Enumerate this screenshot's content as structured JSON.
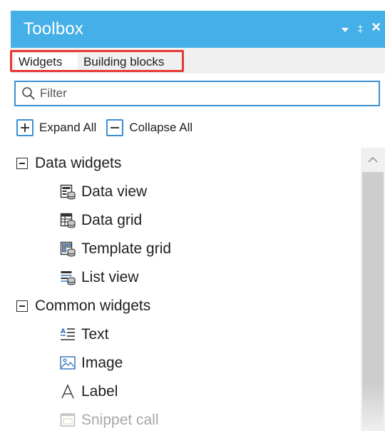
{
  "window": {
    "title": "Toolbox",
    "controls": {
      "pin": "‡",
      "close": "×"
    }
  },
  "tabs": [
    {
      "label": "Widgets",
      "active": true
    },
    {
      "label": "Building blocks",
      "active": false
    }
  ],
  "filter": {
    "placeholder": "Filter",
    "value": ""
  },
  "actions": {
    "expand_all": "Expand All",
    "collapse_all": "Collapse All"
  },
  "tree": {
    "groups": [
      {
        "label": "Data widgets",
        "items": [
          {
            "label": "Data view",
            "icon": "data-view-icon"
          },
          {
            "label": "Data grid",
            "icon": "data-grid-icon"
          },
          {
            "label": "Template grid",
            "icon": "template-grid-icon"
          },
          {
            "label": "List view",
            "icon": "list-view-icon"
          }
        ]
      },
      {
        "label": "Common widgets",
        "items": [
          {
            "label": "Text",
            "icon": "text-icon"
          },
          {
            "label": "Image",
            "icon": "image-icon"
          },
          {
            "label": "Label",
            "icon": "label-icon"
          },
          {
            "label": "Snippet call",
            "icon": "snippet-call-icon",
            "disabled": true
          }
        ]
      }
    ]
  },
  "colors": {
    "titlebar": "#45b0e8",
    "accent": "#3a8fd8",
    "highlight": "#e53935"
  }
}
